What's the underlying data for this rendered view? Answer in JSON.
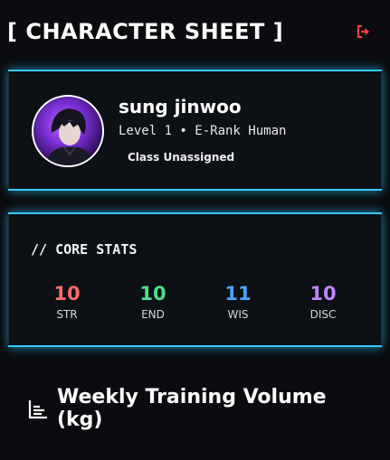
{
  "header": {
    "title": "[ CHARACTER SHEET ]",
    "logout_icon": "logout-icon"
  },
  "profile": {
    "username": "sung jinwoo",
    "level_line": "Level 1 • E-Rank Human",
    "class_badge": "Class Unassigned"
  },
  "core_stats": {
    "title": "// CORE STATS",
    "items": [
      {
        "value": "10",
        "label": "STR",
        "color": "#ff6b6b"
      },
      {
        "value": "10",
        "label": "END",
        "color": "#4be08a"
      },
      {
        "value": "11",
        "label": "WIS",
        "color": "#4aa3ff"
      },
      {
        "value": "10",
        "label": "DISC",
        "color": "#c084fc"
      }
    ]
  },
  "training": {
    "title": "Weekly Training Volume (kg)",
    "icon": "bar-chart-icon"
  },
  "colors": {
    "accent": "#35c8ff",
    "logout": "#ff3b3b"
  }
}
